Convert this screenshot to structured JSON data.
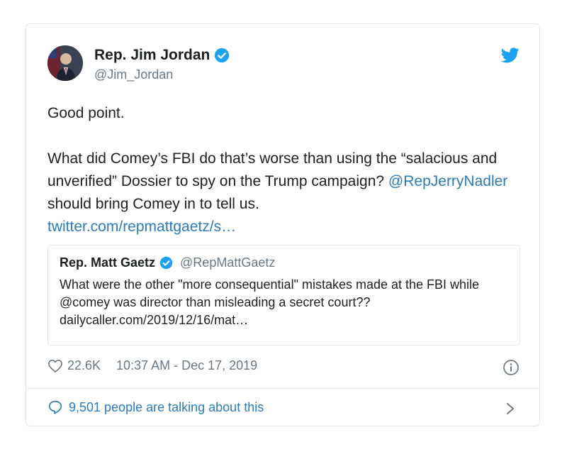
{
  "author": {
    "name": "Rep. Jim Jordan",
    "handle": "@Jim_Jordan"
  },
  "tweet": {
    "line1": "Good point.",
    "line2": "What did Comey’s FBI do that’s worse than using the “salacious and unverified” Dossier to spy on the Trump campaign?",
    "mention": "@RepJerryNadler",
    "line3_rest": " should bring Comey in to tell us.",
    "link": "twitter.com/repmattgaetz/s…"
  },
  "quoted": {
    "name": "Rep. Matt Gaetz",
    "handle": "@RepMattGaetz",
    "text": "What were the other \"more consequential\" mistakes made at the FBI while @comey was director than misleading a secret court??",
    "link": "dailycaller.com/2019/12/16/mat…"
  },
  "meta": {
    "likes": "22.6K",
    "timestamp": "10:37 AM - Dec 17, 2019"
  },
  "footer": {
    "talking": "9,501 people are talking about this"
  },
  "colors": {
    "brand": "#1da1f2",
    "link": "#2b7bb9",
    "muted": "#697882"
  },
  "icons": {
    "verified": "verified-badge-icon",
    "logo": "twitter-bird-icon",
    "like": "heart-icon",
    "info": "info-icon",
    "reply": "speech-bubble-icon",
    "chevron": "chevron-right-icon"
  }
}
